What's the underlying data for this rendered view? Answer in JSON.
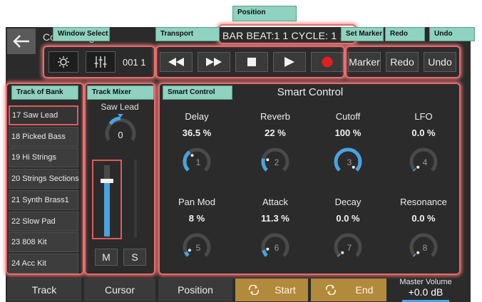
{
  "header": {
    "app_name": "Control Logic",
    "position_text": "BAR BEAT:1 1 CYCLE: 1 1 ..."
  },
  "window_select": {
    "display_value": "001 1"
  },
  "transport": {},
  "set_marker": {
    "marker_label": "Marker",
    "redo_label": "Redo",
    "undo_label": "Undo"
  },
  "annotations": {
    "position": "Position",
    "window_select": "Window Select",
    "transport": "Transport",
    "set_marker": "Set Marker",
    "redo": "Redo",
    "undo": "Undo",
    "track_of_bank": "Track of Bank",
    "track_mixer": "Track Mixer",
    "smart_control": "Smart Control"
  },
  "tracks": [
    {
      "label": "17 Saw Lead",
      "selected": true
    },
    {
      "label": "18 Picked Bass"
    },
    {
      "label": "19 Hi Strings"
    },
    {
      "label": "20 Strings Sections"
    },
    {
      "label": "21 Synth Brass1"
    },
    {
      "label": "22 Slow Pad"
    },
    {
      "label": "23 808 Kit"
    },
    {
      "label": "24 Acc Kit"
    }
  ],
  "mixer": {
    "track_name": "Saw Lead",
    "pan_value": "0",
    "mute_label": "M",
    "solo_label": "S",
    "fader_level": 0.78
  },
  "smart_control": {
    "title": "Smart Control",
    "params": [
      {
        "name": "Delay",
        "value": "36.5 %",
        "number": "1",
        "level": 0.365
      },
      {
        "name": "Reverb",
        "value": "22 %",
        "number": "2",
        "level": 0.22
      },
      {
        "name": "Cutoff",
        "value": "100 %",
        "number": "3",
        "level": 1.0
      },
      {
        "name": "LFO",
        "value": "0.0 %",
        "number": "4",
        "level": 0.0
      },
      {
        "name": "Pan Mod",
        "value": "8 %",
        "number": "5",
        "level": 0.08
      },
      {
        "name": "Attack",
        "value": "11.3 %",
        "number": "6",
        "level": 0.113
      },
      {
        "name": "Decay",
        "value": "0.0 %",
        "number": "7",
        "level": 0.0
      },
      {
        "name": "Resonance",
        "value": "0.0 %",
        "number": "8",
        "level": 0.0
      }
    ]
  },
  "bottom": {
    "track": "Track",
    "cursor": "Cursor",
    "position": "Position",
    "start": "Start",
    "end": "End",
    "master_volume_label": "Master Volume",
    "master_volume_value": "+0.0 dB"
  },
  "colors": {
    "accent": "#4aa3df",
    "highlight": "#e86a6a",
    "label_bg": "#8fd2bf",
    "record": "#e02020",
    "gold": "#b28a3c"
  }
}
